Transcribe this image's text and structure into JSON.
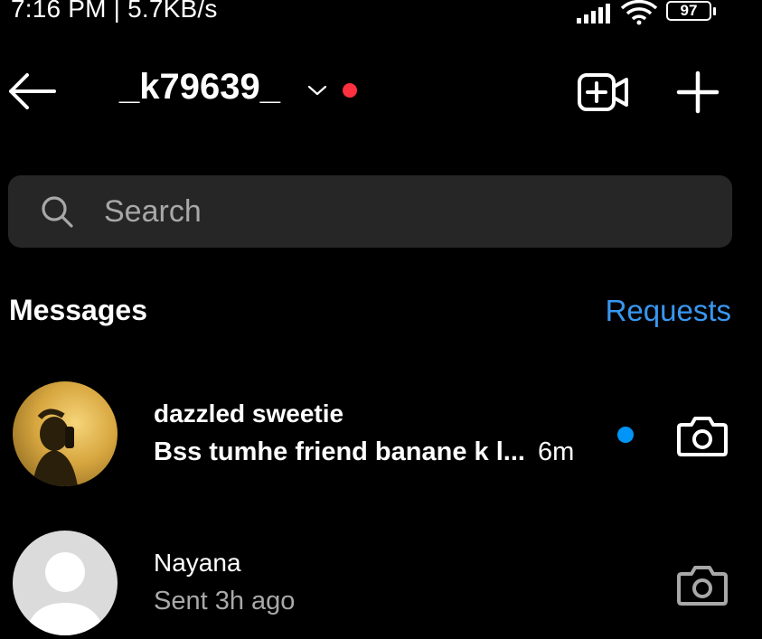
{
  "status_bar": {
    "time_speed": "7:16 PM | 5.7KB/s",
    "battery": "97"
  },
  "header": {
    "username": "_k79639_"
  },
  "search": {
    "placeholder": "Search"
  },
  "messages_section": {
    "title": "Messages",
    "requests_label": "Requests"
  },
  "threads": [
    {
      "name": "dazzled sweetie",
      "preview": "Bss tumhe friend banane k l...",
      "time": "6m",
      "unread": true
    },
    {
      "name": "Nayana",
      "preview": "Sent 3h ago",
      "unread": false
    }
  ],
  "colors": {
    "background": "#000000",
    "accent_link": "#3897f0",
    "unread_dot": "#0095f6",
    "online_dot": "#ff3040",
    "search_bg": "#262626"
  }
}
